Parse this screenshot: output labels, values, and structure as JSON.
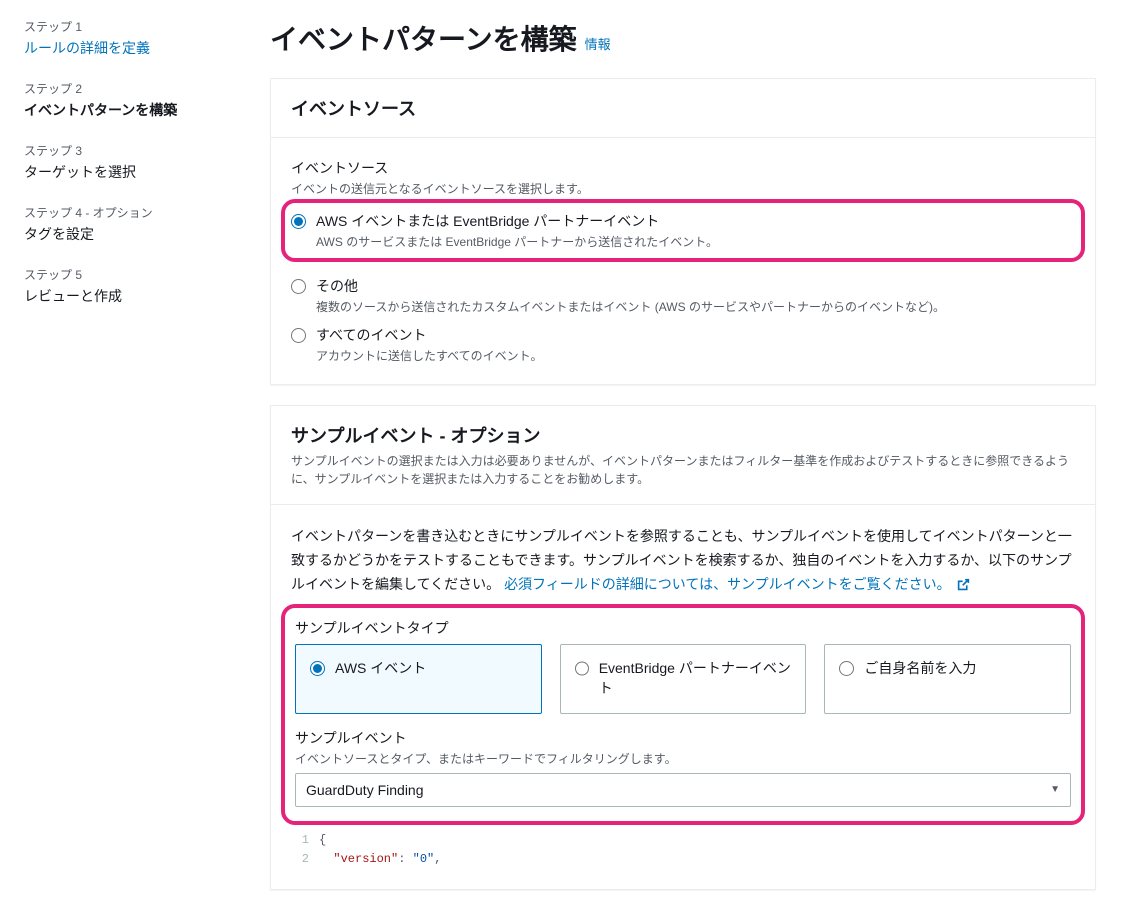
{
  "sidebar": {
    "steps": [
      {
        "label": "ステップ 1",
        "title": "ルールの詳細を定義"
      },
      {
        "label": "ステップ 2",
        "title": "イベントパターンを構築"
      },
      {
        "label": "ステップ 3",
        "title": "ターゲットを選択"
      },
      {
        "label": "ステップ 4 - オプション",
        "title": "タグを設定"
      },
      {
        "label": "ステップ 5",
        "title": "レビューと作成"
      }
    ]
  },
  "page": {
    "title": "イベントパターンを構築",
    "info": "情報"
  },
  "eventSource": {
    "heading": "イベントソース",
    "fieldLabel": "イベントソース",
    "fieldDesc": "イベントの送信元となるイベントソースを選択します。",
    "opt1": {
      "label": "AWS イベントまたは EventBridge パートナーイベント",
      "desc": "AWS のサービスまたは EventBridge パートナーから送信されたイベント。"
    },
    "opt2": {
      "label": "その他",
      "desc": "複数のソースから送信されたカスタムイベントまたはイベント (AWS のサービスやパートナーからのイベントなど)。"
    },
    "opt3": {
      "label": "すべてのイベント",
      "desc": "アカウントに送信したすべてのイベント。"
    }
  },
  "sample": {
    "heading": "サンプルイベント - オプション",
    "headingDesc": "サンプルイベントの選択または入力は必要ありませんが、イベントパターンまたはフィルター基準を作成およびテストするときに参照できるように、サンプルイベントを選択または入力することをお勧めします。",
    "bodyText": "イベントパターンを書き込むときにサンプルイベントを参照することも、サンプルイベントを使用してイベントパターンと一致するかどうかをテストすることもできます。サンプルイベントを検索するか、独自のイベントを入力するか、以下のサンプルイベントを編集してください。",
    "bodyLink": "必須フィールドの詳細については、サンプルイベントをご覧ください。",
    "typeLabel": "サンプルイベントタイプ",
    "typeOpt1": "AWS イベント",
    "typeOpt2": "EventBridge パートナーイベント",
    "typeOpt3": "ご自身名前を入力",
    "eventLabel": "サンプルイベント",
    "eventDesc": "イベントソースとタイプ、またはキーワードでフィルタリングします。",
    "selectedEvent": "GuardDuty Finding",
    "code": {
      "l1n": "1",
      "l1": "{",
      "l2n": "2",
      "l2a": "  \"version\"",
      "l2b": ": ",
      "l2c": "\"0\"",
      "l2d": ","
    }
  }
}
